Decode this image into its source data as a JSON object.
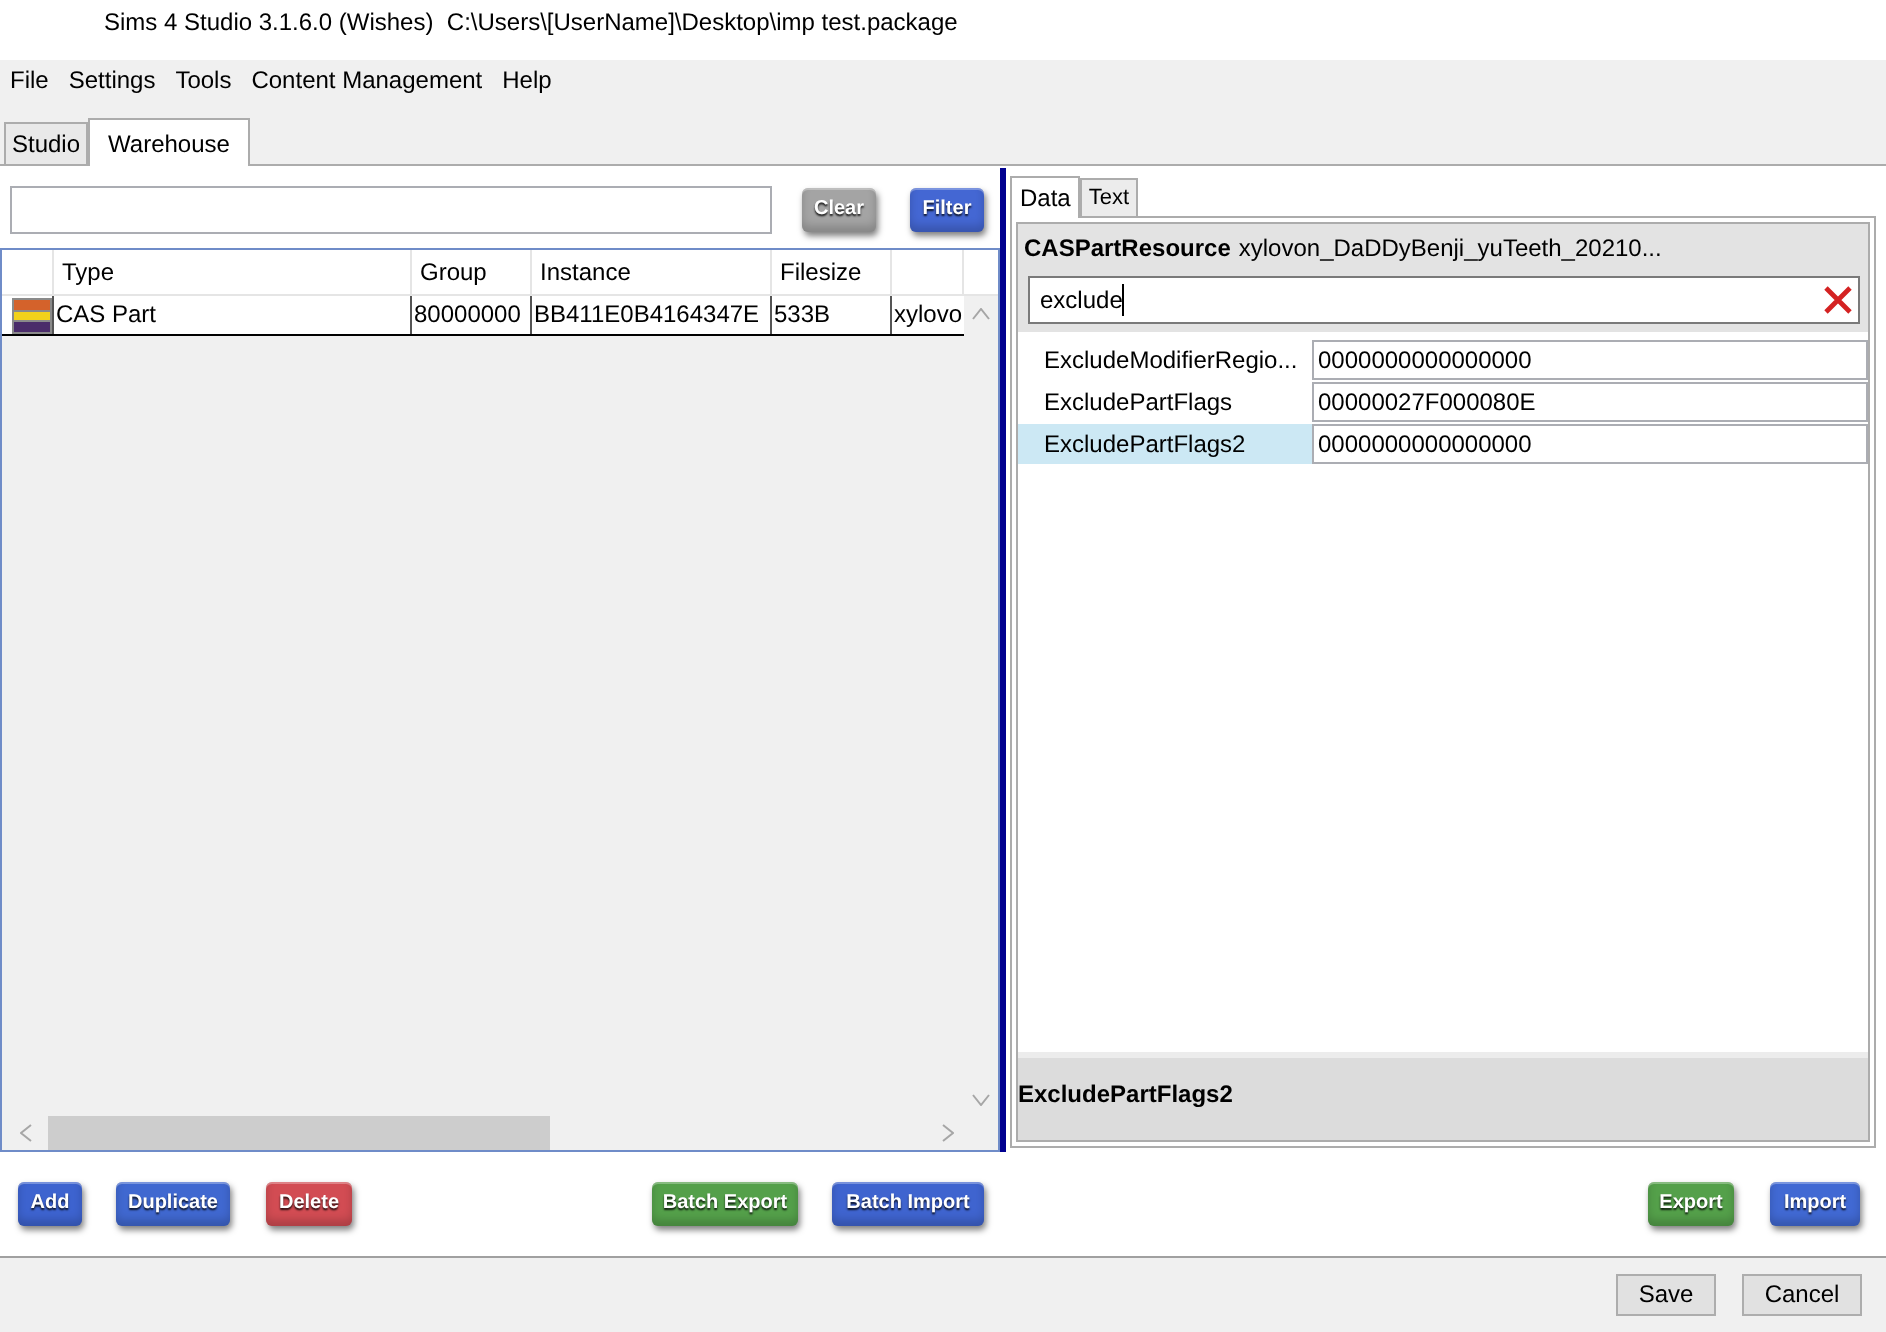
{
  "window": {
    "title": "Sims 4 Studio 3.1.6.0 (Wishes)  C:\\Users\\[UserName]\\Desktop\\imp test.package"
  },
  "menu": [
    "File",
    "Settings",
    "Tools",
    "Content Management",
    "Help"
  ],
  "tabs": [
    {
      "label": "Studio",
      "selected": false
    },
    {
      "label": "Warehouse",
      "selected": true
    }
  ],
  "warehouse": {
    "filter_buttons": [
      {
        "label": "Clear",
        "color": "#a4a4a4"
      },
      {
        "label": "Filter",
        "color": "#4467d3"
      }
    ],
    "table": {
      "columns": [
        "Type",
        "Group",
        "Instance",
        "Filesize"
      ],
      "rows": [
        {
          "cells": [
            "CAS Part",
            "80000000",
            "BB411E0B4164347E",
            "533B",
            "xylovo"
          ]
        }
      ]
    },
    "actions": [
      {
        "label": "Add",
        "color": "#3d63cf"
      },
      {
        "label": "Duplicate",
        "color": "#4068d0"
      },
      {
        "label": "Delete",
        "color": "#d24c53"
      },
      {
        "label": "Batch Export",
        "color": "#54a04a"
      },
      {
        "label": "Batch Import",
        "color": "#3f64cf"
      }
    ]
  },
  "detail": {
    "tabs": [
      {
        "label": "Data",
        "selected": true
      },
      {
        "label": "Text",
        "selected": false
      }
    ],
    "resource_type": "CASPartResource",
    "resource_name": "xylovon_DaDDyBenji_yuTeeth_20210...",
    "search": {
      "value": "exclude"
    },
    "properties": [
      {
        "name": "ExcludeModifierRegio...",
        "value": "0000000000000000",
        "selected": false
      },
      {
        "name": "ExcludePartFlags",
        "value": "00000027F000080E",
        "selected": false
      },
      {
        "name": "ExcludePartFlags2",
        "value": "0000000000000000",
        "selected": true
      }
    ],
    "description": {
      "title": "ExcludePartFlags2"
    },
    "actions": [
      {
        "label": "Export",
        "color": "#54a04a"
      },
      {
        "label": "Import",
        "color": "#4169d3"
      }
    ]
  },
  "dialog_buttons": [
    "Save",
    "Cancel"
  ]
}
